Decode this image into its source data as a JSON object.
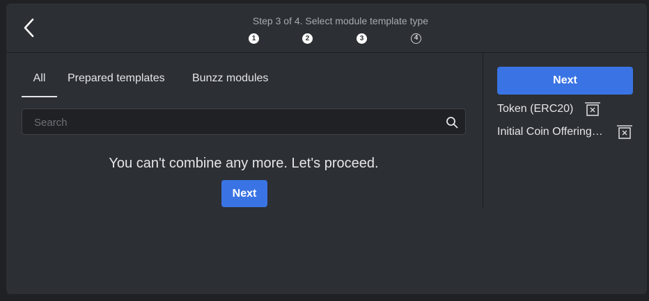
{
  "header": {
    "step_title": "Step 3 of 4. Select module template type",
    "steps": [
      {
        "label": "1",
        "state": "done"
      },
      {
        "label": "2",
        "state": "done"
      },
      {
        "label": "3",
        "state": "done"
      },
      {
        "label": "4",
        "state": "todo"
      }
    ],
    "back_icon": "chevron-left-icon"
  },
  "tabs": [
    {
      "label": "All",
      "active": true
    },
    {
      "label": "Prepared templates",
      "active": false
    },
    {
      "label": "Bunzz modules",
      "active": false
    }
  ],
  "search": {
    "placeholder": "Search",
    "value": "",
    "icon": "search-icon"
  },
  "main": {
    "message": "You can't combine any more. Let's proceed.",
    "next_label": "Next"
  },
  "sidebar": {
    "next_label": "Next",
    "selected_modules": [
      {
        "label": "Token (ERC20)",
        "icon": "remove-trash-icon"
      },
      {
        "label": "Initial Coin Offering…",
        "icon": "remove-trash-icon"
      }
    ]
  },
  "colors": {
    "background": "#1f2124",
    "panel": "#2c2f33",
    "accent": "#3a74e4",
    "text": "#e4e6e9",
    "muted": "#a7abb1"
  }
}
